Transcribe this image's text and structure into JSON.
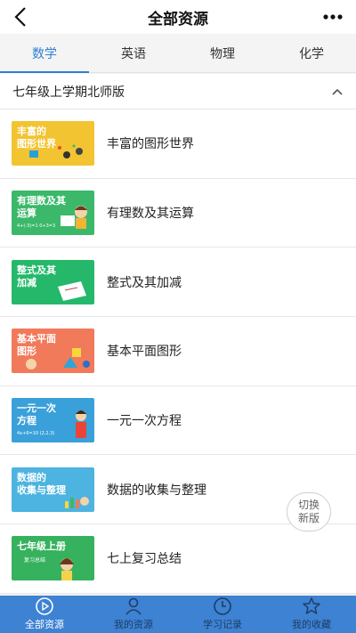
{
  "header": {
    "title": "全部资源",
    "back_icon": "back-arrow-icon",
    "more_icon": "more-icon"
  },
  "tabs": [
    {
      "label": "数学",
      "active": true
    },
    {
      "label": "英语",
      "active": false
    },
    {
      "label": "物理",
      "active": false
    },
    {
      "label": "化学",
      "active": false
    }
  ],
  "section": {
    "label": "七年级上学期北师版",
    "icon": "chevron-up-icon"
  },
  "items": [
    {
      "thumb_text": "丰富的\n图形世界",
      "name": "丰富的图形世界"
    },
    {
      "thumb_text": "有理数及其\n运算",
      "name": "有理数及其运算",
      "thumb_sub": "4+(-3)=1 0+3=3"
    },
    {
      "thumb_text": "整式及其\n加减",
      "name": "整式及其加减"
    },
    {
      "thumb_text": "基本平面\n图形",
      "name": "基本平面图形"
    },
    {
      "thumb_text": "一元一次\n方程",
      "name": "一元一次方程",
      "thumb_sub": "4x+6=10 (2,2,3)"
    },
    {
      "thumb_text": "数据的\n收集与整理",
      "name": "数据的收集与整理"
    },
    {
      "thumb_text": "七年级上册",
      "name": "七上复习总结",
      "thumb_sub": "复习总结"
    }
  ],
  "switch": {
    "line1": "切换",
    "line2": "新版"
  },
  "bottom_nav": [
    {
      "label": "全部资源",
      "icon": "play-circle-icon",
      "active": true
    },
    {
      "label": "我的资源",
      "icon": "user-icon",
      "active": false
    },
    {
      "label": "学习记录",
      "icon": "clock-icon",
      "active": false
    },
    {
      "label": "我的收藏",
      "icon": "star-icon",
      "active": false
    }
  ],
  "colors": {
    "accent": "#2f7fd2",
    "bottom_bar": "#3d82d3"
  }
}
